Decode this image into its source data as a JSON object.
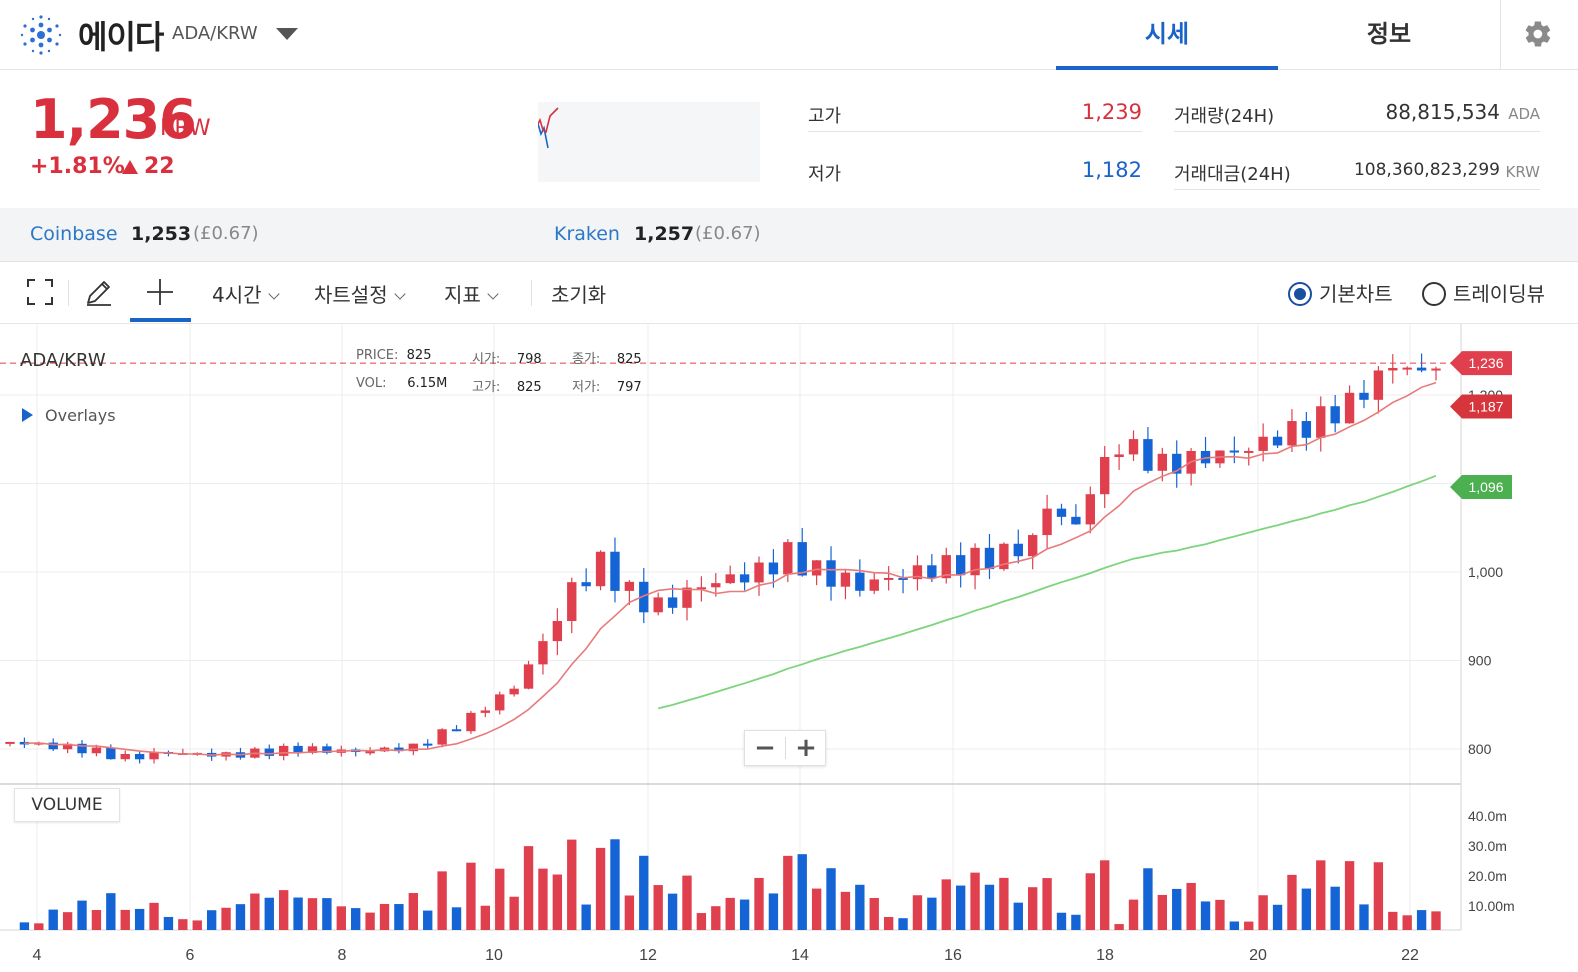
{
  "header": {
    "coin_name": "에이다",
    "pair": "ADA/KRW",
    "tabs": [
      {
        "label": "시세",
        "active": true
      },
      {
        "label": "정보",
        "active": false
      }
    ],
    "settings_icon": "gear-icon"
  },
  "price": {
    "current": "1,236",
    "unit": "KRW",
    "change_pct": "+1.81%",
    "change_abs": "22",
    "change_dir": "up",
    "color_up": "#d9303e",
    "color_down": "#1a63c8"
  },
  "stats": {
    "high_label": "고가",
    "high": "1,239",
    "low_label": "저가",
    "low": "1,182",
    "volume_label": "거래량(24H)",
    "volume": "88,815,534",
    "volume_unit": "ADA",
    "amount_label": "거래대금(24H)",
    "amount": "108,360,823,299",
    "amount_unit": "KRW"
  },
  "exchanges": [
    {
      "name": "Coinbase",
      "price": "1,253",
      "gbp": "(£0.67)"
    },
    {
      "name": "Kraken",
      "price": "1,257",
      "gbp": "(£0.67)"
    }
  ],
  "toolbar": {
    "interval": "4시간",
    "chart_settings": "차트설정",
    "indicators": "지표",
    "reset": "초기화",
    "chart_modes": [
      {
        "label": "기본차트",
        "selected": true
      },
      {
        "label": "트레이딩뷰",
        "selected": false
      }
    ]
  },
  "chart_legend": {
    "pair": "ADA/KRW",
    "price_label": "PRICE:",
    "price": "825",
    "open_label": "시가:",
    "open": "798",
    "close_label": "종가:",
    "close": "825",
    "vol_label": "VOL:",
    "vol": "6.15M",
    "high_label": "고가:",
    "high": "825",
    "low_label": "저가:",
    "low": "797",
    "overlays": "Overlays",
    "volume_panel": "VOLUME",
    "zoom_out": "−",
    "zoom_in": "+"
  },
  "chart_data": {
    "type": "candlestick",
    "price_axis": {
      "ticks": [
        "800",
        "900",
        "1,000",
        "1,200"
      ],
      "ylim": [
        775,
        1275
      ]
    },
    "volume_axis": {
      "ticks": [
        "10.00m",
        "20.0m",
        "30.0m",
        "40.0m"
      ],
      "ylim": [
        0,
        45
      ]
    },
    "x_ticks": [
      "4",
      "6",
      "8",
      "10",
      "12",
      "14",
      "16",
      "18",
      "20",
      "22"
    ],
    "price_tags": [
      {
        "label": "1,236",
        "value": 1236,
        "color": "#e0404d"
      },
      {
        "label": "1,187",
        "value": 1187,
        "color": "#d6353c"
      },
      {
        "label": "1,096",
        "value": 1096,
        "color": "#4caf50"
      }
    ],
    "last_price_line": 1236,
    "ma_short": {
      "color": "#e87a7a"
    },
    "ma_long": {
      "color": "#7dd47d"
    },
    "up_color": "#e0404d",
    "down_color": "#1464d6"
  }
}
